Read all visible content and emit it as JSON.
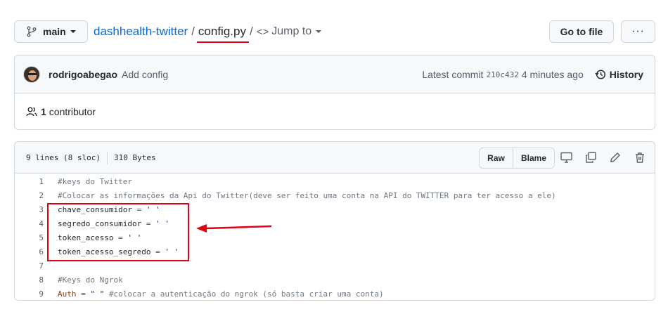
{
  "header": {
    "branch": "main",
    "repo": "dashhealth-twitter",
    "separator": "/",
    "file": "config.py",
    "jump_sep": "/",
    "jump_glyph": "<>",
    "jump": "Jump to",
    "goto_file": "Go to file",
    "more": "···"
  },
  "commit": {
    "author": "rodrigoabegao",
    "message": "Add config",
    "latest_label": "Latest commit",
    "sha": "210c432",
    "time": "4 minutes ago",
    "history": "History"
  },
  "contributors": {
    "count": "1",
    "label": "contributor"
  },
  "file_header": {
    "lines": "9 lines (8 sloc)",
    "size": "310 Bytes",
    "raw": "Raw",
    "blame": "Blame"
  },
  "code": [
    {
      "n": "1",
      "text": "#keys do Twitter"
    },
    {
      "n": "2",
      "text": "#Colocar as informações da Api do Twitter(deve ser feito uma conta na API do TWITTER para ter acesso a ele)"
    },
    {
      "n": "3",
      "var": "chave_consumidor",
      "op": " = ",
      "str": "' '"
    },
    {
      "n": "4",
      "var": "segredo_consumidor",
      "op": " = ",
      "str": "' '"
    },
    {
      "n": "5",
      "var": "token_acesso",
      "op": " = ",
      "str": "' '"
    },
    {
      "n": "6",
      "var": "token_acesso_segredo",
      "op": " = ",
      "str": "' '"
    },
    {
      "n": "7",
      "text": ""
    },
    {
      "n": "8",
      "text": "#Keys do Ngrok"
    },
    {
      "n": "9",
      "var": "Auth",
      "op": " = ",
      "str": "\" \"",
      "comment": " #colocar a autenticação do ngrok (só basta criar uma conta)"
    }
  ],
  "colors": {
    "annotation": "#e3000f",
    "link": "#0969da"
  }
}
